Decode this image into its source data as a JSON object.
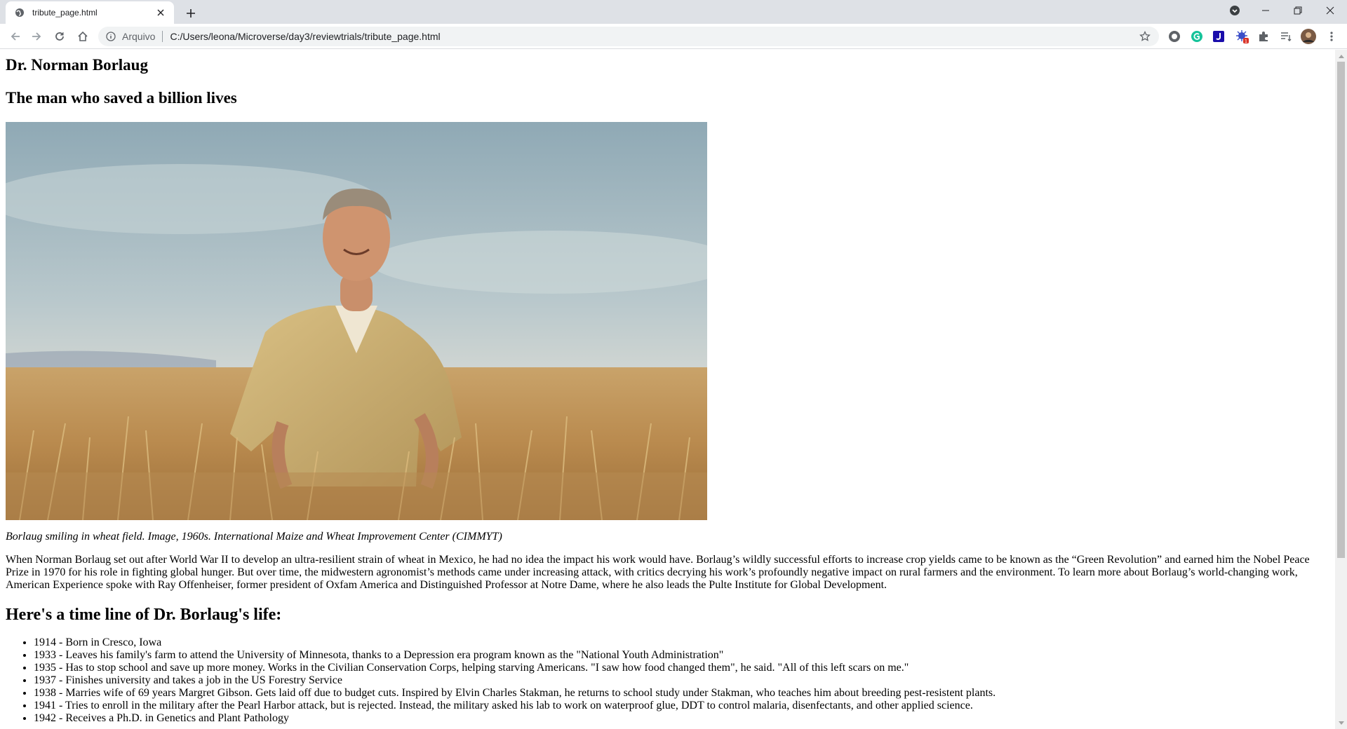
{
  "browser": {
    "tab": {
      "title": "tribute_page.html",
      "favicon": "globe-icon"
    },
    "omnibox": {
      "scheme_label": "Arquivo",
      "url": "C:/Users/leona/Microverse/day3/reviewtrials/tribute_page.html"
    },
    "extensions": [
      "extension-1-icon",
      "grammarly-icon",
      "j-extension-icon",
      "bug-extension-icon",
      "puzzle-icon",
      "reading-list-icon",
      "profile-avatar"
    ],
    "extension_badge": "1",
    "accent_color": "#1a73e8"
  },
  "page": {
    "title": "Dr. Norman Borlaug",
    "subtitle": "The man who saved a billion lives",
    "image_caption": "Borlaug smiling in wheat field. Image, 1960s. International Maize and Wheat Improvement Center (CIMMYT)",
    "intro": "When Norman Borlaug set out after World War II to develop an ultra-resilient strain of wheat in Mexico, he had no idea the impact his work would have. Borlaug’s wildly successful efforts to increase crop yields came to be known as the “Green Revolution” and earned him the Nobel Peace Prize in 1970 for his role in fighting global hunger. But over time, the midwestern agronomist’s methods came under increasing attack, with critics decrying his work’s profoundly negative impact on rural farmers and the environment. To learn more about Borlaug’s world-changing work, American Experience spoke with Ray Offenheiser, former president of Oxfam America and Distinguished Professor at Notre Dame, where he also leads the Pulte Institute for Global Development.",
    "timeline_heading": "Here's a time line of Dr. Borlaug's life:",
    "timeline": [
      "1914 - Born in Cresco, Iowa",
      "1933 - Leaves his family's farm to attend the University of Minnesota, thanks to a Depression era program known as the \"National Youth Administration\"",
      "1935 - Has to stop school and save up more money. Works in the Civilian Conservation Corps, helping starving Americans. \"I saw how food changed them\", he said. \"All of this left scars on me.\"",
      "1937 - Finishes university and takes a job in the US Forestry Service",
      "1938 - Marries wife of 69 years Margret Gibson. Gets laid off due to budget cuts. Inspired by Elvin Charles Stakman, he returns to school study under Stakman, who teaches him about breeding pest-resistent plants.",
      "1941 - Tries to enroll in the military after the Pearl Harbor attack, but is rejected. Instead, the military asked his lab to work on waterproof glue, DDT to control malaria, disenfectants, and other applied science.",
      "1942 - Receives a Ph.D. in Genetics and Plant Pathology"
    ]
  }
}
